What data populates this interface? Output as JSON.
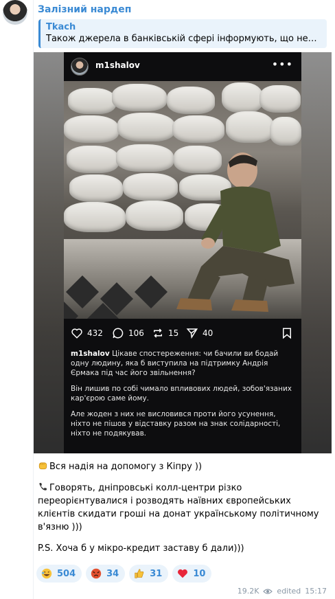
{
  "message": {
    "sender": "Залізний нардеп",
    "reply": {
      "name": "Tkach",
      "text": "Також джерела в банківській сфері інформують, що невдов…"
    },
    "body": [
      "Вся надія на допомогу з Кіпру ))",
      "Говорять, дніпровські колл-центри різко переорієнтувалися і розводять наївних європейських клієнтів скидати гроші на донат українському політичному в'язню )))",
      "P.S. Хоча б у мікро-кредит заставу б дали)))"
    ],
    "reactions": [
      {
        "emoji": "rolling-laughing",
        "count": "504"
      },
      {
        "emoji": "angry-face",
        "count": "34"
      },
      {
        "emoji": "thumbs-up",
        "count": "31"
      },
      {
        "emoji": "red-heart",
        "count": "10"
      }
    ],
    "views": "19.2K",
    "edited_label": "edited",
    "time": "15:17"
  },
  "instagram_post": {
    "username": "m1shalov",
    "likes": "432",
    "comments": "106",
    "reposts": "15",
    "shares": "40",
    "caption_user": "m1shalov",
    "caption": [
      "Цікаве спостереження: чи бачили ви бодай одну людину, яка б виступила на підтримку Андрія Єрмака під час його звільнення?",
      "Він лишив по собі чимало впливових людей, зобов'язаних кар'єрою саме йому.",
      "Але жоден з них не висловився проти його усунення, ніхто не пішов у відставку разом на знак солідарності, ніхто не подякував."
    ]
  },
  "colors": {
    "accent": "#3a8ad4",
    "reaction_bg": "#eaf3fb",
    "ig_bg": "#0d0d0f"
  }
}
